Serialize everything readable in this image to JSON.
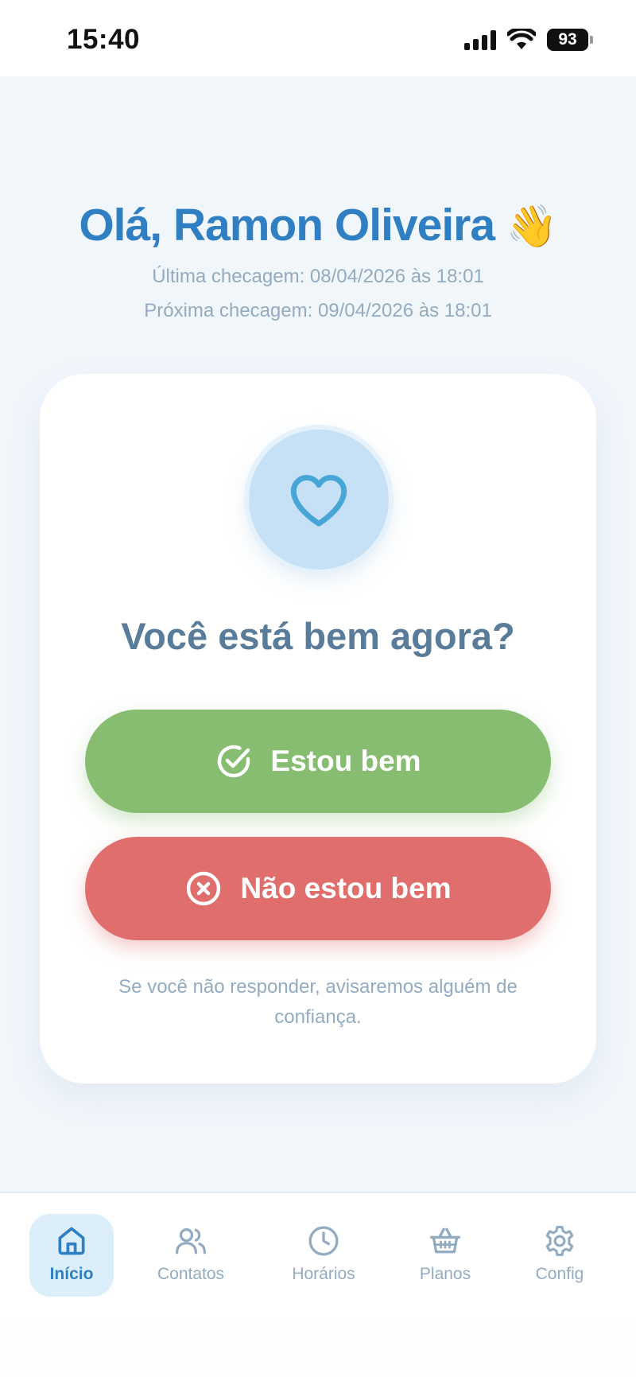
{
  "status_bar": {
    "time": "15:40",
    "battery": "93"
  },
  "header": {
    "greeting": "Olá, Ramon Oliveira",
    "wave_emoji": "👋",
    "last_check": "Última checagem: 08/04/2026 às 18:01",
    "next_check": "Próxima checagem: 09/04/2026 às 18:01"
  },
  "card": {
    "icon": "heart-icon",
    "question": "Você está bem agora?",
    "ok_button": "Estou bem",
    "not_ok_button": "Não estou bem",
    "note": "Se você não responder, avisaremos alguém de confiança."
  },
  "tabs": [
    {
      "label": "Início",
      "icon": "home-icon",
      "active": true
    },
    {
      "label": "Contatos",
      "icon": "users-icon",
      "active": false
    },
    {
      "label": "Horários",
      "icon": "clock-icon",
      "active": false
    },
    {
      "label": "Planos",
      "icon": "basket-icon",
      "active": false
    },
    {
      "label": "Config",
      "icon": "gear-icon",
      "active": false
    }
  ],
  "colors": {
    "accent": "#2f7fc2",
    "ok": "#86bd71",
    "not_ok": "#e06e6d",
    "muted": "#93abc0",
    "background": "#f1f6fb"
  }
}
